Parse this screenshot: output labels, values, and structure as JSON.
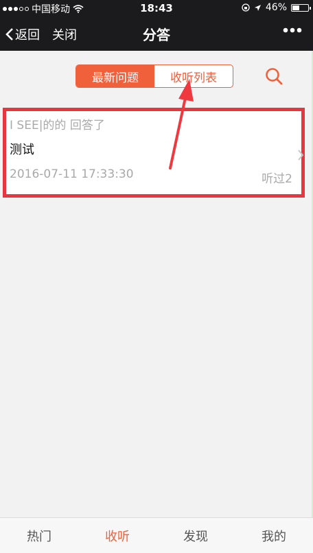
{
  "status_bar": {
    "carrier": "中国移动",
    "time": "18:43",
    "battery_text": "46%",
    "battery_level": 0.46
  },
  "nav": {
    "back_label": "返回",
    "close_label": "关闭",
    "title": "分答"
  },
  "segmented": {
    "tabs": [
      "最新问题",
      "收听列表"
    ],
    "active_index": 0
  },
  "card": {
    "author": "I SEE|的的 回答了",
    "question": "测试",
    "timestamp": "2016-07-11 17:33:30",
    "listens": "听过2"
  },
  "tab_bar": {
    "items": [
      "热门",
      "收听",
      "发现",
      "我的"
    ],
    "active_index": 1
  },
  "colors": {
    "accent": "#f0603a",
    "highlight_red": "#e8353f",
    "dark_bar": "#1b1b1d"
  }
}
